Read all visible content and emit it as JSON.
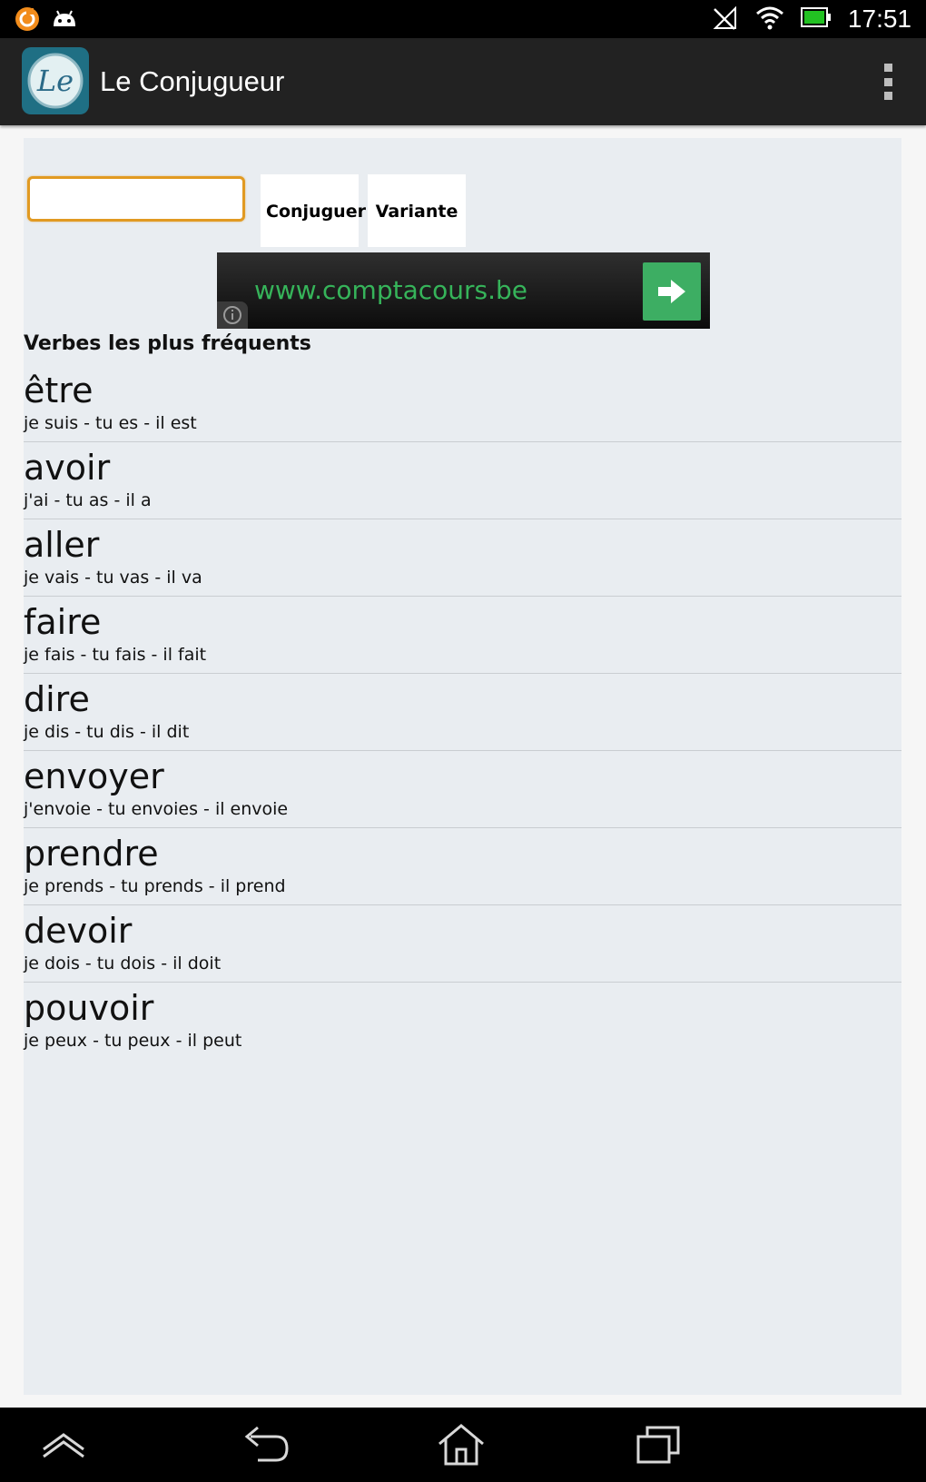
{
  "status_bar": {
    "time": "17:51",
    "icons": [
      "app-notification-icon",
      "android-icon",
      "no-signal-icon",
      "wifi-icon",
      "battery-icon"
    ]
  },
  "action_bar": {
    "title": "Le Conjugueur",
    "app_icon_text": "Le",
    "overflow_icon": "overflow-menu-icon"
  },
  "search": {
    "value": "",
    "placeholder": "",
    "conjugate_label": "Conjuguer",
    "variant_label": "Variante"
  },
  "ad": {
    "url": "www.comptacours.be",
    "go_icon": "arrow-right-icon",
    "info_icon": "info-icon"
  },
  "section_title": "Verbes les plus fréquents",
  "verbs": [
    {
      "name": "être",
      "conj": "je suis - tu es - il est"
    },
    {
      "name": "avoir",
      "conj": "j'ai - tu as - il a"
    },
    {
      "name": "aller",
      "conj": "je vais - tu vas - il va"
    },
    {
      "name": "faire",
      "conj": "je fais - tu fais - il fait"
    },
    {
      "name": "dire",
      "conj": "je dis - tu dis - il dit"
    },
    {
      "name": "envoyer",
      "conj": "j'envoie - tu envoies - il envoie"
    },
    {
      "name": "prendre",
      "conj": "je prends - tu prends - il prend"
    },
    {
      "name": "devoir",
      "conj": "je dois - tu dois - il doit"
    },
    {
      "name": "pouvoir",
      "conj": "je peux - tu peux - il peut"
    }
  ],
  "nav_bar": {
    "icons": [
      "collapse-icon",
      "back-icon",
      "home-icon",
      "recent-apps-icon"
    ]
  },
  "colors": {
    "accent_input_border": "#e19a22",
    "ad_url": "#36b45a",
    "ad_button": "#3dae63",
    "panel_background": "#e9edf1"
  }
}
